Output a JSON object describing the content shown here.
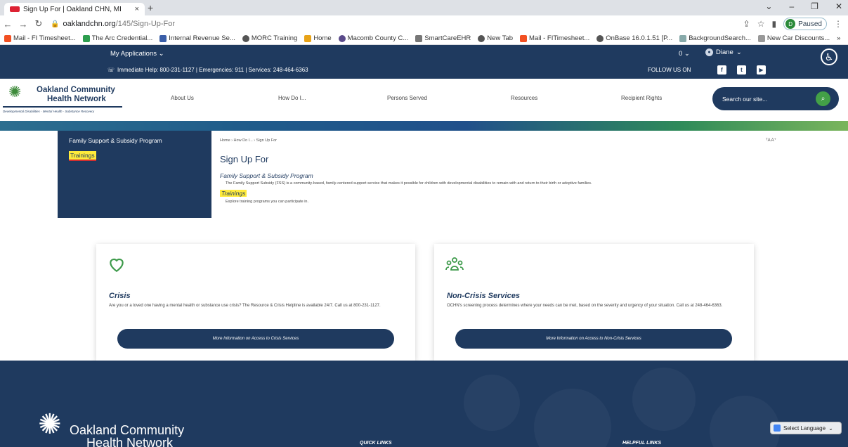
{
  "browser": {
    "tab_title": "Sign Up For | Oakland CHN, MI",
    "tab_close": "×",
    "new_tab": "+",
    "url_host": "oaklandchn.org",
    "url_path": "/145/Sign-Up-For",
    "profile_initial": "D",
    "profile_status": "Paused",
    "bookmarks": [
      "Mail - FI Timesheet...",
      "The Arc Credential...",
      "Internal Revenue Se...",
      "MORC Training",
      "Home",
      "Macomb County C...",
      "SmartCareEHR",
      "New Tab",
      "Mail - FITimesheet...",
      "OnBase 16.0.1.51 [P...",
      "BackgroundSearch...",
      "New Car Discounts..."
    ],
    "bookmarks_overflow": "»"
  },
  "topbar": {
    "my_applications": "My Applications",
    "counter": "0",
    "user": "Diane",
    "help_text": "Immediate Help: 800-231-1127 | Emergencies: 911 | Services: 248-464-6363",
    "follow": "FOLLOW US ON",
    "social_facebook": "f",
    "social_twitter": "t",
    "social_youtube": "▶"
  },
  "header": {
    "logo_line1": "Oakland Community",
    "logo_line2": "Health Network",
    "logo_tagline": "Developmental Disabilities - Mental Health - Substance Recovery",
    "nav": [
      "About Us",
      "How Do I...",
      "Persons Served",
      "Resources",
      "Recipient Rights"
    ],
    "search_placeholder": "Search our site..."
  },
  "sidebar": {
    "items": [
      "Family Support & Subsidy Program",
      "Trainings"
    ]
  },
  "main": {
    "breadcrumb": "Home › How Do I... › Sign Up For",
    "font_controls": "ᵀA A⁺",
    "title": "Sign Up For",
    "sections": [
      {
        "heading": "Family Support & Subsidy Program",
        "text": "The Family Support Subsidy (FSS) is a community-based, family-centered support service that makes it possible for children with developmental disabilities to remain with and return to their birth or adoptive families."
      },
      {
        "heading": "Trainings",
        "text": "Explore training programs you can participate in."
      }
    ]
  },
  "cards": [
    {
      "title": "Crisis",
      "text": "Are you or a loved one having a mental health or substance use crisis? The Resource & Crisis Helpline is available 24/7. Call us at 800-231-1127.",
      "button": "More Information on Access to Crisis Services"
    },
    {
      "title": "Non-Crisis Services",
      "text": "OCHN's screening process determines where your needs can be met, based on the severity and urgency of your situation. Call us at 248-464-6363.",
      "button": "More Information on Access to Non-Crisis Services"
    }
  ],
  "footer": {
    "logo_line1": "Oakland Community",
    "logo_line2": "Health Network",
    "quick_links": "QUICK LINKS",
    "helpful_links": "HELPFUL LINKS",
    "language": "Select Language"
  }
}
